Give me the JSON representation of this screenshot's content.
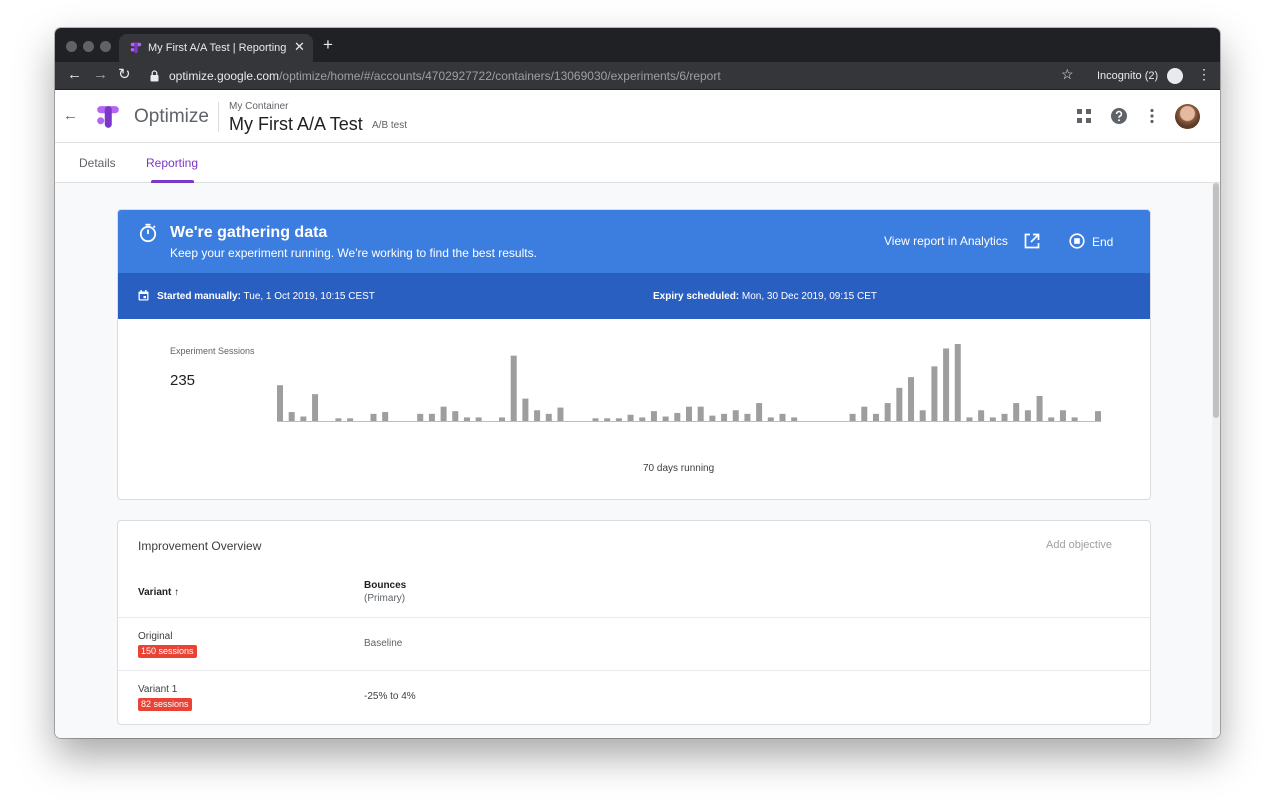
{
  "browser": {
    "tab_title": "My First A/A Test | Reporting -",
    "url_host": "optimize.google.com",
    "url_path": "/optimize/home/#/accounts/4702927722/containers/13069030/experiments/6/report",
    "incognito_label": "Incognito (2)",
    "close_glyph": "✕",
    "newtab_glyph": "+",
    "back_glyph": "←",
    "forward_glyph": "→",
    "reload_glyph": "↻",
    "star_glyph": "☆",
    "menu_glyph": "⋮"
  },
  "header": {
    "back_glyph": "←",
    "app_name": "Optimize",
    "container": "My Container",
    "experiment": "My First A/A Test",
    "experiment_type": "A/B test"
  },
  "tabs": [
    {
      "label": "Details"
    },
    {
      "label": "Reporting"
    }
  ],
  "status": {
    "title": "We're gathering data",
    "subtitle": "Keep your experiment running. We're working to find the best results.",
    "analytics_link": "View report in Analytics",
    "end_label": "End",
    "started_label": "Started manually:",
    "started_value": " Tue, 1 Oct 2019, 10:15 CEST",
    "expiry_label": "Expiry scheduled:",
    "expiry_value": " Mon, 30 Dec 2019, 09:15 CET"
  },
  "sessions": {
    "label": "Experiment Sessions",
    "value": "235",
    "running": "70 days running"
  },
  "chart_data": {
    "type": "bar",
    "title": "",
    "xlabel": "",
    "ylabel": "",
    "days": 70,
    "values": [
      4,
      1,
      0.5,
      3,
      0,
      0.3,
      0.3,
      0,
      0.8,
      1,
      0,
      0,
      0.8,
      0.8,
      1.6,
      1.1,
      0.4,
      0.4,
      0,
      0.4,
      7.3,
      2.5,
      1.2,
      0.8,
      1.5,
      0,
      0,
      0.3,
      0.3,
      0.3,
      0.7,
      0.4,
      1.1,
      0.5,
      0.9,
      1.6,
      1.6,
      0.6,
      0.8,
      1.2,
      0.8,
      2,
      0.4,
      0.8,
      0.4,
      0,
      0,
      0,
      0,
      0.8,
      1.6,
      0.8,
      2,
      3.7,
      4.9,
      1.2,
      6.1,
      8.1,
      8.6,
      0.4,
      1.2,
      0.4,
      0.8,
      2,
      1.2,
      2.8,
      0.4,
      1.2,
      0.4,
      0,
      1.1
    ],
    "ylim": [
      0,
      8.6
    ]
  },
  "overview": {
    "title": "Improvement Overview",
    "add_objective": "Add objective",
    "col_variant": "Variant ↑",
    "col_metric": "Bounces",
    "col_metric_sub": "(Primary)",
    "rows": [
      {
        "name": "Original",
        "sessions": "150 sessions",
        "value": "Baseline"
      },
      {
        "name": "Variant 1",
        "sessions": "82 sessions",
        "value": "-25% to 4%"
      }
    ]
  },
  "colors": {
    "accent": "#7b37c8",
    "banner": "#3c7ee0",
    "banner_dark": "#2a5fc2",
    "badge": "#ea4335",
    "bar": "#9e9e9e"
  }
}
